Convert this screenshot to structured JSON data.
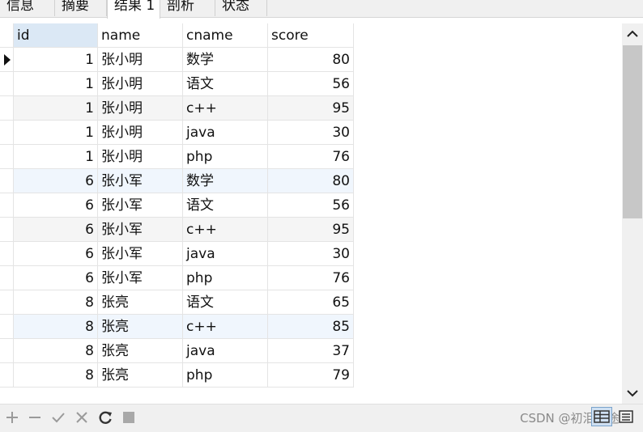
{
  "tabs": [
    {
      "label": "信息",
      "active": false
    },
    {
      "label": "摘要",
      "active": false
    },
    {
      "label": "结果 1",
      "active": true
    },
    {
      "label": "剖析",
      "active": false
    },
    {
      "label": "状态",
      "active": false
    }
  ],
  "grid": {
    "columns": [
      "id",
      "name",
      "cname",
      "score"
    ],
    "selected_column": "id",
    "current_row": 0,
    "rows": [
      {
        "id": "1",
        "name": "张小明",
        "cname": "数学",
        "score": "80"
      },
      {
        "id": "1",
        "name": "张小明",
        "cname": "语文",
        "score": "56"
      },
      {
        "id": "1",
        "name": "张小明",
        "cname": "c++",
        "score": "95"
      },
      {
        "id": "1",
        "name": "张小明",
        "cname": "java",
        "score": "30"
      },
      {
        "id": "1",
        "name": "张小明",
        "cname": "php",
        "score": "76"
      },
      {
        "id": "6",
        "name": "张小军",
        "cname": "数学",
        "score": "80"
      },
      {
        "id": "6",
        "name": "张小军",
        "cname": "语文",
        "score": "56"
      },
      {
        "id": "6",
        "name": "张小军",
        "cname": "c++",
        "score": "95"
      },
      {
        "id": "6",
        "name": "张小军",
        "cname": "java",
        "score": "30"
      },
      {
        "id": "6",
        "name": "张小军",
        "cname": "php",
        "score": "76"
      },
      {
        "id": "8",
        "name": "张亮",
        "cname": "语文",
        "score": "65"
      },
      {
        "id": "8",
        "name": "张亮",
        "cname": "c++",
        "score": "85"
      },
      {
        "id": "8",
        "name": "张亮",
        "cname": "java",
        "score": "37"
      },
      {
        "id": "8",
        "name": "张亮",
        "cname": "php",
        "score": "79"
      }
    ]
  },
  "toolbar": {
    "buttons": [
      "add-icon",
      "remove-icon",
      "apply-icon",
      "discard-icon",
      "refresh-icon",
      "stop-icon"
    ],
    "watermark": "CSDN @初泪志途"
  },
  "colors": {
    "selected_header": "#dbe8f5",
    "row_alt": "#f5f5f5",
    "row_highlight": "#f0f6fd",
    "scrollbar_thumb": "#c7c7c7"
  }
}
